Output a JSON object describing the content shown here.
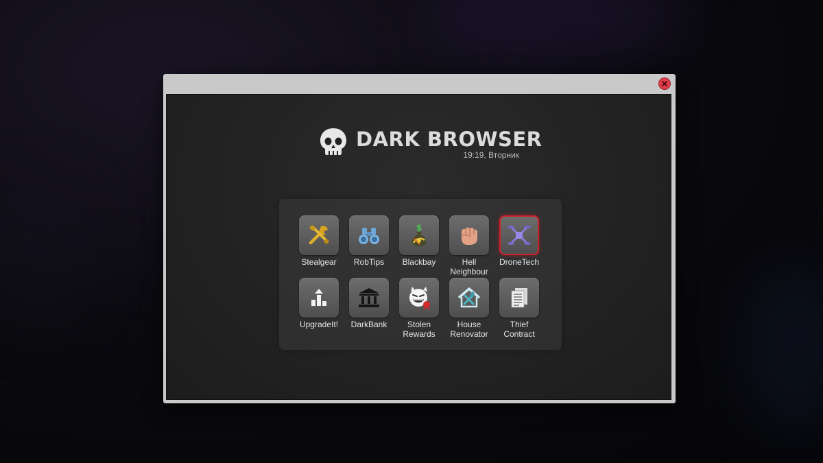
{
  "browser": {
    "title": "DARK BROWSER",
    "time": "19:19, Вторник"
  },
  "apps": [
    {
      "label": "Stealgear",
      "icon": "tools-icon"
    },
    {
      "label": "RobTips",
      "icon": "binoculars-icon"
    },
    {
      "label": "Blackbay",
      "icon": "money-bag-icon"
    },
    {
      "label": "Hell\nNeighbour",
      "icon": "fist-icon"
    },
    {
      "label": "DroneTech",
      "icon": "drone-icon",
      "selected": true
    },
    {
      "label": "UpgradeIt!",
      "icon": "upgrade-icon"
    },
    {
      "label": "DarkBank",
      "icon": "bank-icon"
    },
    {
      "label": "Stolen\nRewards",
      "icon": "devil-smiley-icon"
    },
    {
      "label": "House\nRenovator",
      "icon": "house-tools-icon"
    },
    {
      "label": "Thief\nContract",
      "icon": "contract-document-icon"
    }
  ],
  "colors": {
    "selection": "#d0202a",
    "close": "#e23b4a",
    "window_frame": "#c9c9c9"
  }
}
